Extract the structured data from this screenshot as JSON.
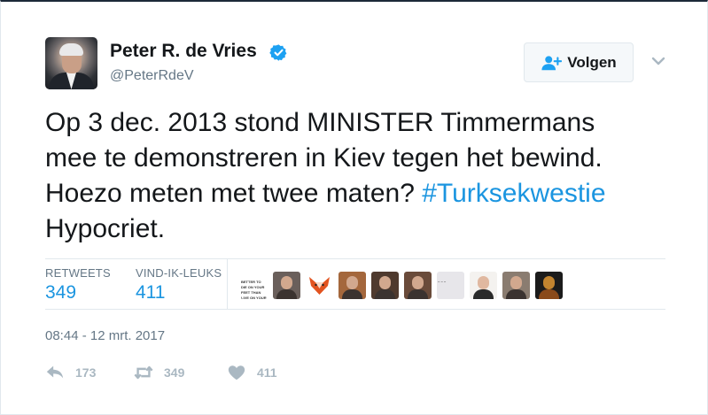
{
  "user": {
    "name": "Peter R. de Vries",
    "handle": "@PeterRdeV",
    "verified": true
  },
  "follow_button": {
    "label": "Volgen",
    "icon": "follow-user-icon"
  },
  "menu": {
    "icon": "chevron-down-icon"
  },
  "tweet": {
    "line1": "Op 3 dec. 2013 stond MINISTER Timmermans",
    "line2": "mee te demonstreren in Kiev tegen het bewind.",
    "line3_text": "Hoezo meten met twee maten? ",
    "hashtag": "#Turksekwestie",
    "line4": "Hypocriet."
  },
  "stats": {
    "retweets_label": "RETWEETS",
    "retweets_value": "349",
    "likes_label": "VIND-IK-LEUKS",
    "likes_value": "411"
  },
  "likers": [
    {
      "kind": "text",
      "text": "BETTER TO DIE ON YOUR FEET THAN LIVE ON YOUR KNEES"
    },
    {
      "kind": "photo",
      "bg": "#6a5f5b"
    },
    {
      "kind": "fox",
      "bg": "#ffffff"
    },
    {
      "kind": "photo",
      "bg": "#a4673c"
    },
    {
      "kind": "photo",
      "bg": "#4f3a2e"
    },
    {
      "kind": "photo",
      "bg": "#6a4b3a"
    },
    {
      "kind": "text",
      "text": "~ ~ ~",
      "bg": "#e7e6ea"
    },
    {
      "kind": "photo",
      "bg": "#f4f2ef"
    },
    {
      "kind": "photo",
      "bg": "#8a7c70"
    },
    {
      "kind": "photo",
      "bg": "#1b1b1b"
    }
  ],
  "timestamp": "08:44 - 12 mrt. 2017",
  "actions": {
    "reply_count": "173",
    "retweet_count": "349",
    "like_count": "411"
  },
  "colors": {
    "link": "#1b95e0",
    "muted": "#657786",
    "border": "#e1e8ed",
    "action": "#aab8c2"
  }
}
